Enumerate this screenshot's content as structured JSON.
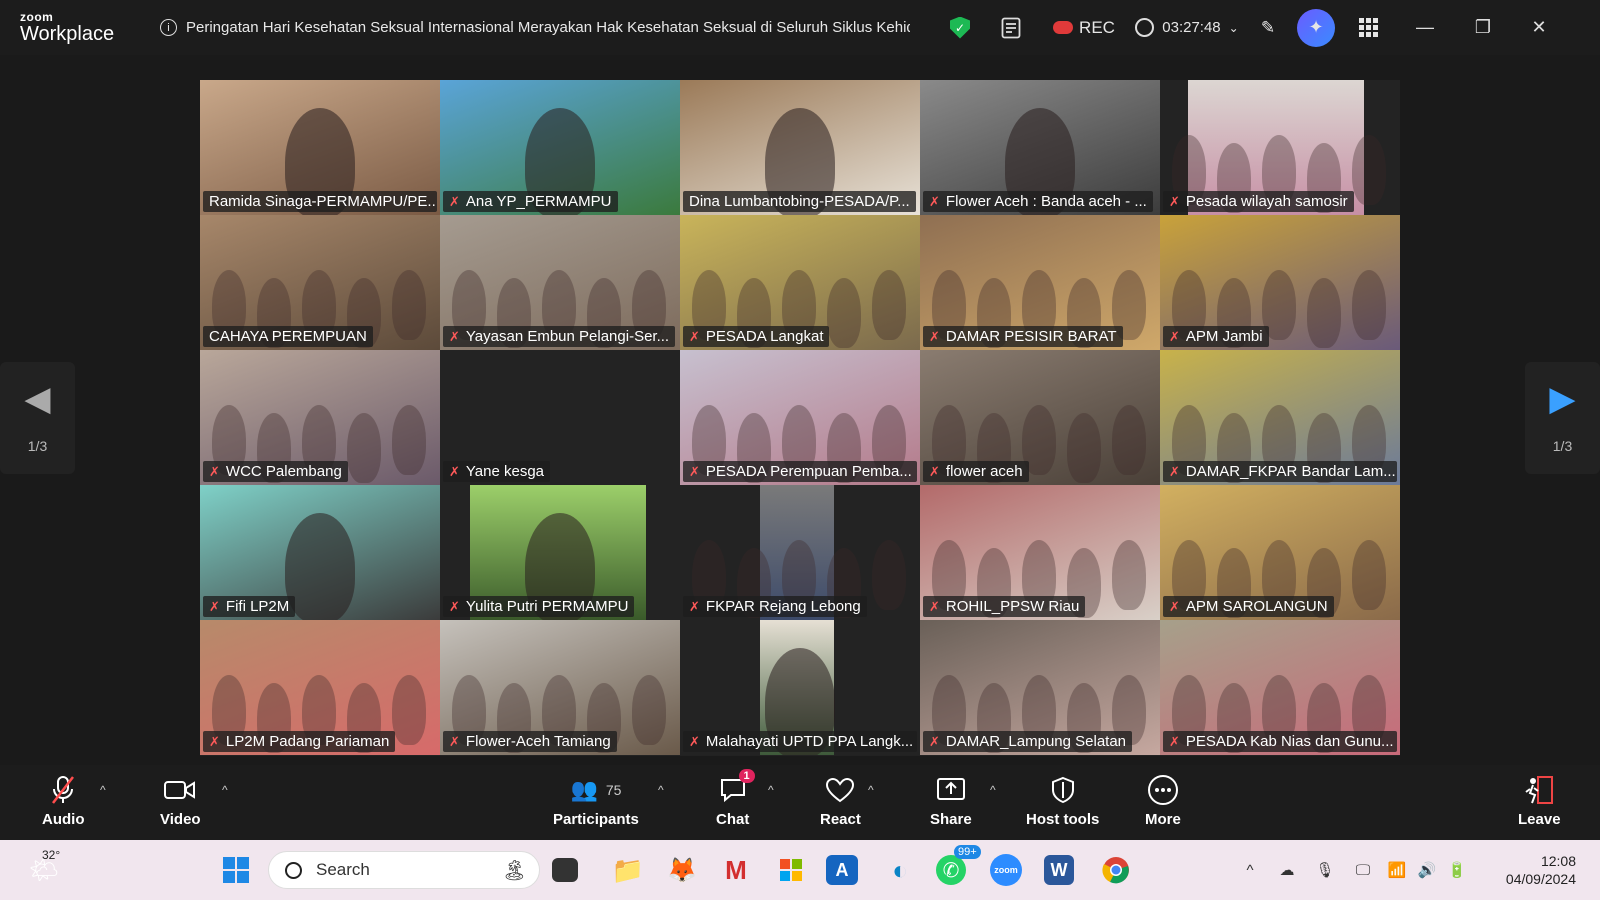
{
  "app": {
    "brand_small": "zoom",
    "brand_large": "Workplace"
  },
  "topbar": {
    "topic": "Peringatan Hari Kesehatan Seksual Internasional Merayakan Hak Kesehatan Seksual di Seluruh Siklus Kehidupa",
    "rec_label": "REC",
    "timer": "03:27:48"
  },
  "gallery": {
    "page_left": "1/3",
    "page_right": "1/3",
    "tiles": [
      {
        "name": "Ramida Sinaga-PERMAMPU/PE...",
        "muted": false
      },
      {
        "name": "Ana YP_PERMAMPU",
        "muted": true
      },
      {
        "name": "Dina Lumbantobing-PESADA/P...",
        "muted": false,
        "active": true
      },
      {
        "name": "Flower Aceh : Banda aceh - ...",
        "muted": true
      },
      {
        "name": "Pesada wilayah samosir",
        "muted": true
      },
      {
        "name": "CAHAYA PEREMPUAN",
        "muted": false
      },
      {
        "name": "Yayasan Embun Pelangi-Ser...",
        "muted": true
      },
      {
        "name": "PESADA Langkat",
        "muted": true
      },
      {
        "name": "DAMAR PESISIR BARAT",
        "muted": true
      },
      {
        "name": "APM Jambi",
        "muted": true
      },
      {
        "name": "WCC Palembang",
        "muted": true
      },
      {
        "name": "Yane kesga",
        "muted": true
      },
      {
        "name": "PESADA Perempuan Pemba...",
        "muted": true
      },
      {
        "name": "flower aceh",
        "muted": true
      },
      {
        "name": "DAMAR_FKPAR Bandar Lam...",
        "muted": true
      },
      {
        "name": "Fifi LP2M",
        "muted": true
      },
      {
        "name": "Yulita Putri PERMAMPU",
        "muted": true
      },
      {
        "name": "FKPAR Rejang Lebong",
        "muted": true
      },
      {
        "name": "ROHIL_PPSW Riau",
        "muted": true
      },
      {
        "name": "APM SAROLANGUN",
        "muted": true
      },
      {
        "name": "LP2M Padang Pariaman",
        "muted": true
      },
      {
        "name": "Flower-Aceh Tamiang",
        "muted": true
      },
      {
        "name": "Malahayati UPTD PPA Langk...",
        "muted": true
      },
      {
        "name": "DAMAR_Lampung Selatan",
        "muted": true
      },
      {
        "name": "PESADA Kab Nias dan Gunu...",
        "muted": true
      }
    ]
  },
  "toolbar": {
    "audio": "Audio",
    "video": "Video",
    "participants": "Participants",
    "participants_count": "75",
    "chat": "Chat",
    "chat_badge": "1",
    "react": "React",
    "share": "Share",
    "host_tools": "Host tools",
    "more": "More",
    "leave": "Leave"
  },
  "taskbar": {
    "weather_temp": "32°",
    "search_placeholder": "Search",
    "whatsapp_badge": "99+",
    "time": "12:08",
    "date": "04/09/2024"
  }
}
